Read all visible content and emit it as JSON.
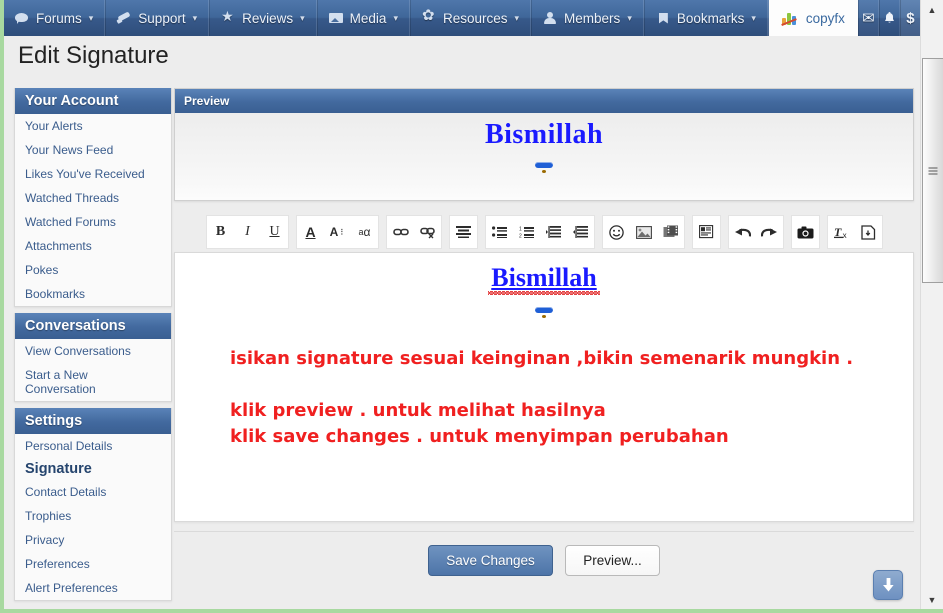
{
  "navbar": {
    "items": [
      {
        "label": "Forums",
        "icon": "forums-icon",
        "caret": "▾"
      },
      {
        "label": "Support",
        "icon": "support-icon",
        "caret": "▾"
      },
      {
        "label": "Reviews",
        "icon": "reviews-icon",
        "caret": "▾"
      },
      {
        "label": "Media",
        "icon": "media-icon",
        "caret": "▾"
      },
      {
        "label": "Resources",
        "icon": "resources-icon",
        "caret": "▾"
      },
      {
        "label": "Members",
        "icon": "members-icon",
        "caret": "▾"
      },
      {
        "label": "Bookmarks",
        "icon": "bookmarks-icon",
        "caret": "▾"
      }
    ],
    "active_tab": "copyfx",
    "icons": {
      "mail": "✉",
      "bell": "🔔",
      "dollar": "$"
    },
    "accent_color": "#3f6699",
    "active_tab_bg": "#fdfdfd"
  },
  "page": {
    "title": "Edit Signature"
  },
  "sidebar": {
    "blocks": [
      {
        "heading": "Your Account",
        "links": [
          "Your Alerts",
          "Your News Feed",
          "Likes You've Received",
          "Watched Threads",
          "Watched Forums",
          "Attachments",
          "Pokes",
          "Bookmarks"
        ]
      },
      {
        "heading": "Conversations",
        "links": [
          "View Conversations",
          "Start a New Conversation"
        ]
      },
      {
        "heading": "Settings",
        "links": [
          "Personal Details",
          "Signature",
          "Contact Details",
          "Trophies",
          "Privacy",
          "Preferences",
          "Alert Preferences"
        ],
        "active_link": "Signature"
      }
    ]
  },
  "preview": {
    "heading": "Preview",
    "signature_text": "Bismillah",
    "signature_color": "#1a1aff",
    "emoji": "cool-sunglasses-face"
  },
  "toolbar": {
    "groups": [
      [
        {
          "name": "bold-button",
          "glyph": "B"
        },
        {
          "name": "italic-button",
          "glyph": "I"
        },
        {
          "name": "underline-button",
          "glyph": "U"
        }
      ],
      [
        {
          "name": "text-color-button",
          "glyph": "A"
        },
        {
          "name": "font-size-button",
          "glyph": "A⋮"
        },
        {
          "name": "font-family-button",
          "glyph": "ªα"
        }
      ],
      [
        {
          "name": "insert-link-button",
          "glyph": "link"
        },
        {
          "name": "unlink-button",
          "glyph": "unlink"
        }
      ],
      [
        {
          "name": "align-button",
          "glyph": "align"
        }
      ],
      [
        {
          "name": "unordered-list-button",
          "glyph": "ul"
        },
        {
          "name": "ordered-list-button",
          "glyph": "ol"
        },
        {
          "name": "outdent-button",
          "glyph": "outdent"
        },
        {
          "name": "indent-button",
          "glyph": "indent"
        }
      ],
      [
        {
          "name": "emoji-button",
          "glyph": "smiley"
        },
        {
          "name": "image-button",
          "glyph": "picture"
        },
        {
          "name": "media-button",
          "glyph": "film"
        }
      ],
      [
        {
          "name": "insert-quote-button",
          "glyph": "quote"
        }
      ],
      [
        {
          "name": "undo-button",
          "glyph": "undo"
        },
        {
          "name": "redo-button",
          "glyph": "redo"
        }
      ],
      [
        {
          "name": "screenshot-button",
          "glyph": "camera"
        }
      ],
      [
        {
          "name": "remove-formatting-button",
          "glyph": "Tx"
        },
        {
          "name": "toggle-bbcode-button",
          "glyph": "source"
        }
      ]
    ]
  },
  "editor": {
    "signature_heading": "Bismillah",
    "heading_color": "#1a1aff",
    "body_color": "#f02020",
    "lines": [
      "isikan signature sesuai keinginan ,bikin semenarik mungkin .",
      "klik preview .  untuk melihat hasilnya",
      "klik save changes .  untuk menyimpan perubahan"
    ],
    "spellcheck_underline_color": "#e02020"
  },
  "buttons": {
    "save": "Save Changes",
    "preview": "Preview...",
    "save_bg": "#4d74a8"
  },
  "floating": {
    "scroll_bottom_icon": "⬇"
  },
  "scrollbar": {
    "up_arrow": "▲",
    "down_arrow": "▼"
  }
}
